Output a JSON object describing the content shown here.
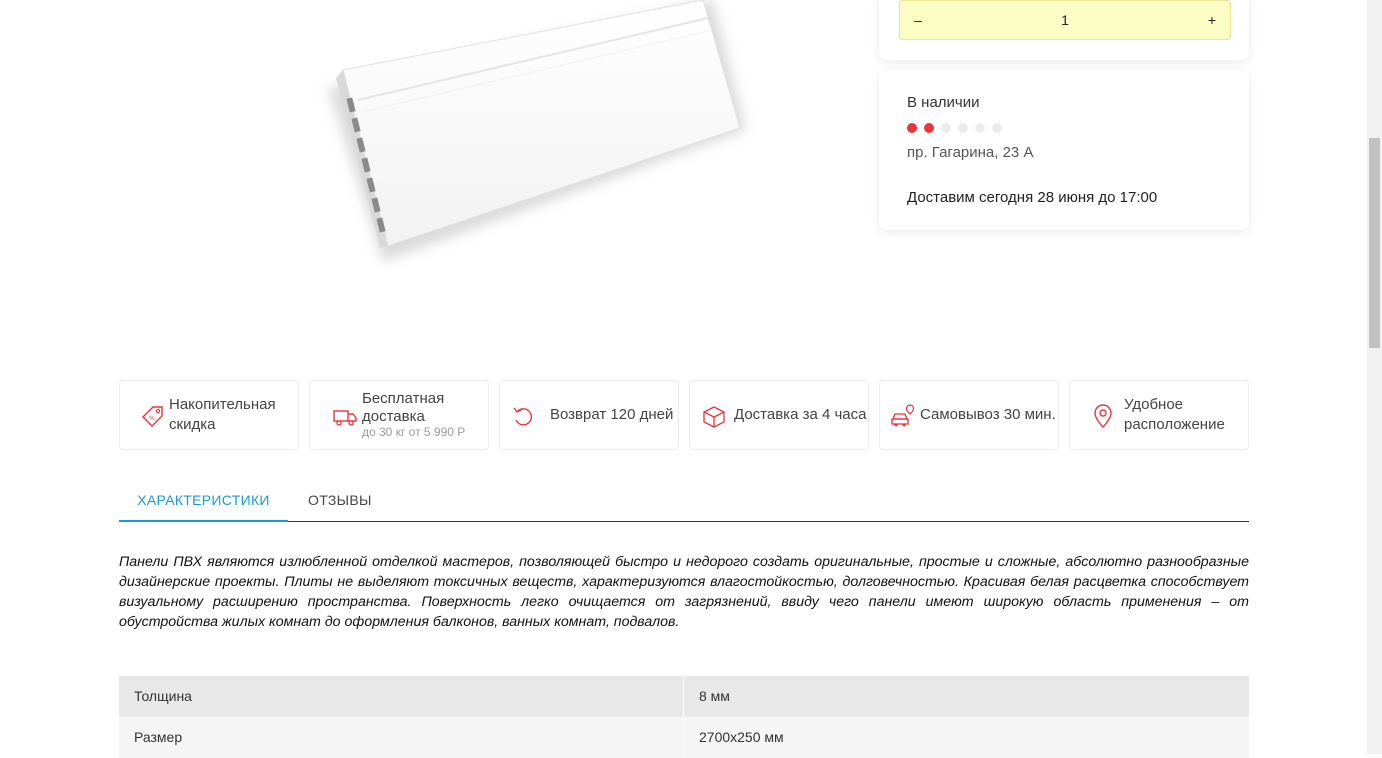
{
  "quantity": {
    "minus": "–",
    "value": "1",
    "plus": "+"
  },
  "stock": {
    "title": "В наличии",
    "level": {
      "filled": 2,
      "total": 6
    },
    "colors": {
      "filled": "#e8343c",
      "empty": "#ececec"
    },
    "address": "пр. Гагарина, 23 А",
    "delivery": "Доставим сегодня 28 июня до 17:00"
  },
  "features": [
    {
      "icon": "discount-tag-icon",
      "line1": "Накопительная",
      "line2": "скидка"
    },
    {
      "icon": "delivery-truck-icon",
      "line1": "Бесплатная",
      "line2": "доставка",
      "sub": "до 30 кг от 5 990 Р"
    },
    {
      "icon": "return-arrow-icon",
      "line1": "Возврат 120 дней"
    },
    {
      "icon": "box-delivery-icon",
      "line1": "Доставка за 4 часа"
    },
    {
      "icon": "car-pickup-icon",
      "line1": "Самовывоз 30 мин."
    },
    {
      "icon": "location-pin-icon",
      "line1": "Удобное",
      "line2": "расположение"
    }
  ],
  "tabs": [
    {
      "label": "ХАРАКТЕРИСТИКИ",
      "active": true
    },
    {
      "label": "ОТЗЫВЫ",
      "active": false
    }
  ],
  "description": "Панели ПВХ являются излюбленной отделкой мастеров, позволяющей быстро и недорого создать оригинальные, простые и сложные, абсолютно разнообразные дизайнерские проекты. Плиты не выделяют токсичных веществ, характеризуются влагостойкостью, долговечностью. Красивая белая расцветка способствует визуальному расширению пространства. Поверхность легко очищается от загрязнений, ввиду чего панели имеют широкую область применения – от обустройства жилых комнат до оформления балконов, ванных комнат, подвалов.",
  "specs": [
    {
      "key": "Толщина",
      "value": "8 мм"
    },
    {
      "key": "Размер",
      "value": "2700x250 мм"
    }
  ],
  "colors": {
    "accent": "#1a9bd1",
    "icon_red": "#e8343c",
    "stepper_bg": "#fcfcc5"
  }
}
